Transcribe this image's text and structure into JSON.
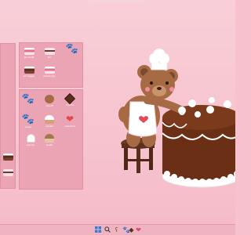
{
  "desktop": {
    "wallpaper": "teddy-bear-chef-chocolate-cake",
    "background_color": "#f7c2cd"
  },
  "left_strip": {
    "icons": [
      {
        "icon": "cake-slice-icon",
        "label": ""
      },
      {
        "icon": "cake-slice-icon",
        "label": ""
      }
    ]
  },
  "top_panel": {
    "icons": [
      {
        "icon": "cake-slice-icon",
        "label": "go small"
      },
      {
        "icon": "cake-slice-icon",
        "label": "sm"
      },
      {
        "icon": "paw-print-icon",
        "label": ""
      },
      {
        "icon": "cake-slice-icon",
        "label": "sm bigger"
      },
      {
        "icon": "cake-slice-icon",
        "label": "pleasingly"
      }
    ]
  },
  "main_panel": {
    "icons": [
      {
        "icon": "paw-print-icon",
        "label": ""
      },
      {
        "icon": "bear-face-icon",
        "label": "sheriff"
      },
      {
        "icon": "chocolate-icon",
        "label": "mocha"
      },
      {
        "icon": "paw-print-icon",
        "label": "paws"
      },
      {
        "icon": "cupcake-icon",
        "label": "vanilla"
      },
      {
        "icon": "heart-icon",
        "label": "valentine"
      },
      {
        "icon": "chef-hat-icon",
        "label": "quickly"
      },
      {
        "icon": "muffin-icon",
        "label": "break"
      }
    ]
  },
  "taskbar": {
    "items": [
      {
        "icon": "start-icon"
      },
      {
        "icon": "search-icon"
      },
      {
        "icon": "bear-icon"
      },
      {
        "icon": "paw-icon"
      },
      {
        "icon": "chocolate-icon"
      },
      {
        "icon": "heart-icon"
      }
    ],
    "start_color": "#2d7fd6"
  }
}
